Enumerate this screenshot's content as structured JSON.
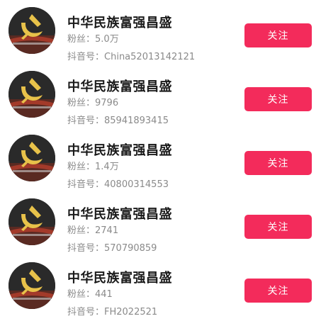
{
  "follow_list": {
    "items": [
      {
        "name": "中华民族富强昌盛",
        "fans_label": "粉丝：",
        "fans_value": "5.0万",
        "douyin_label": "抖音号：",
        "douyin_id": "China52013142121",
        "follow_label": "关注",
        "avatar_icon": "party-emblem-icon"
      },
      {
        "name": "中华民族富强昌盛",
        "fans_label": "粉丝：",
        "fans_value": "9796",
        "douyin_label": "抖音号：",
        "douyin_id": "85941893415",
        "follow_label": "关注",
        "avatar_icon": "party-emblem-icon"
      },
      {
        "name": "中华民族富强昌盛",
        "fans_label": "粉丝：",
        "fans_value": "1.4万",
        "douyin_label": "抖音号：",
        "douyin_id": "40800314553",
        "follow_label": "关注",
        "avatar_icon": "party-emblem-icon"
      },
      {
        "name": "中华民族富强昌盛",
        "fans_label": "粉丝：",
        "fans_value": "2741",
        "douyin_label": "抖音号：",
        "douyin_id": "570790859",
        "follow_label": "关注",
        "avatar_icon": "party-emblem-icon"
      },
      {
        "name": "中华民族富强昌盛",
        "fans_label": "粉丝：",
        "fans_value": "441",
        "douyin_label": "抖音号：",
        "douyin_id": "FH2022521",
        "follow_label": "关注",
        "avatar_icon": "party-emblem-icon"
      }
    ]
  },
  "colors": {
    "follow_button": "#f32b5b",
    "name_text": "#1a1a1a",
    "meta_text": "#8a8a8a"
  }
}
